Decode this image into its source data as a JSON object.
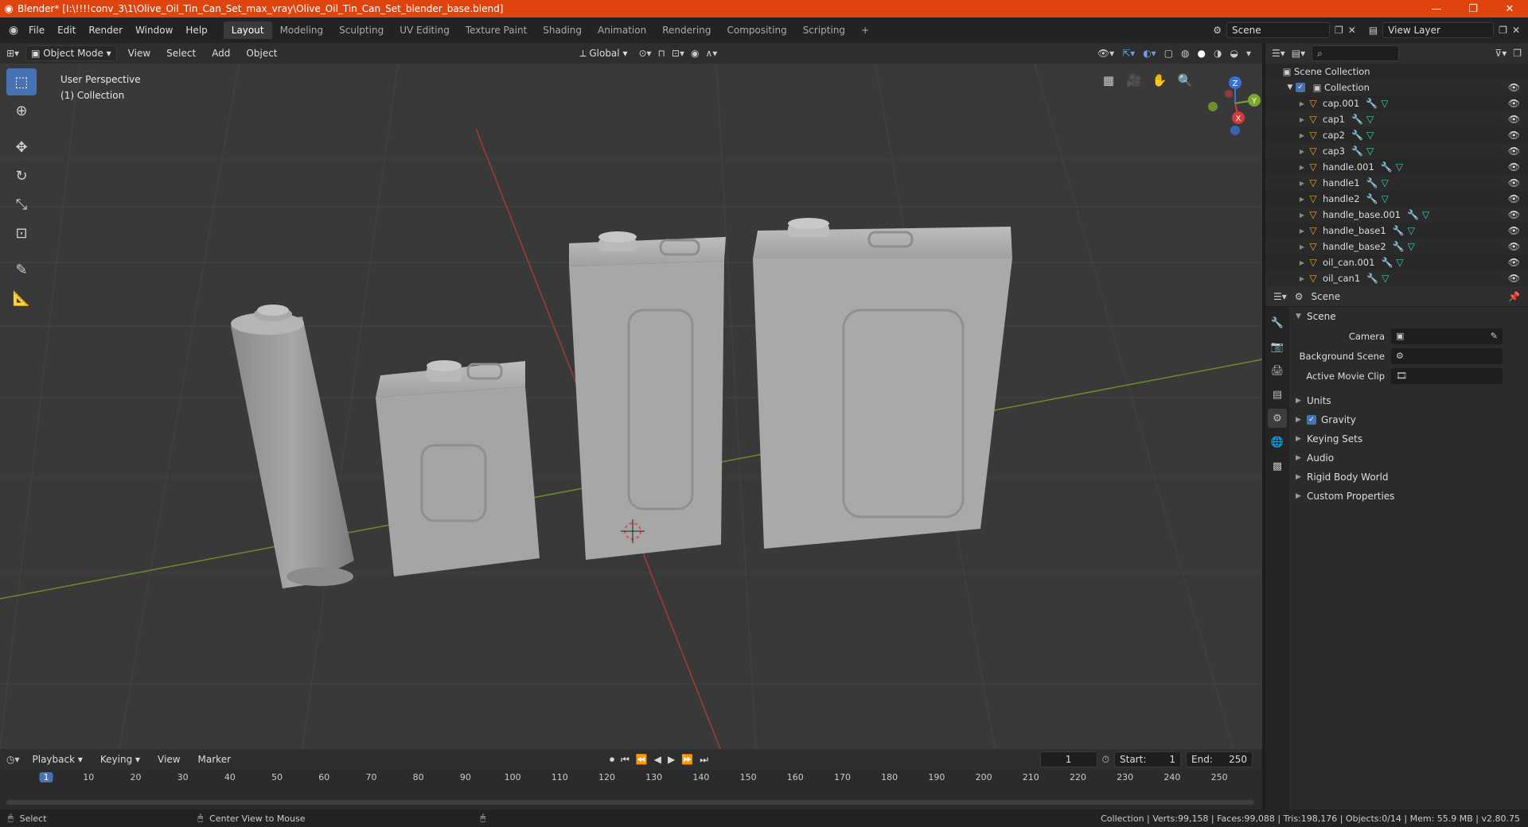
{
  "window": {
    "title": "Blender* [I:\\!!!!conv_3\\1\\Olive_Oil_Tin_Can_Set_max_vray\\Olive_Oil_Tin_Can_Set_blender_base.blend]",
    "minimize": "—",
    "maximize": "❐",
    "close": "✕"
  },
  "menu": [
    "File",
    "Edit",
    "Render",
    "Window",
    "Help"
  ],
  "workspaces": [
    {
      "label": "Layout",
      "active": true
    },
    {
      "label": "Modeling"
    },
    {
      "label": "Sculpting"
    },
    {
      "label": "UV Editing"
    },
    {
      "label": "Texture Paint"
    },
    {
      "label": "Shading"
    },
    {
      "label": "Animation"
    },
    {
      "label": "Rendering"
    },
    {
      "label": "Compositing"
    },
    {
      "label": "Scripting"
    }
  ],
  "add_workspace": "+",
  "scene_selector": "Scene",
  "view_layer": "View Layer",
  "viewport": {
    "mode": "Object Mode",
    "menus": [
      "View",
      "Select",
      "Add",
      "Object"
    ],
    "orientation": "Global",
    "overlay_label": "User Perspective",
    "collection_label": "(1) Collection",
    "gizmo": {
      "z": "Z",
      "y": "Y",
      "x": "X"
    }
  },
  "outliner": {
    "scene_collection": "Scene Collection",
    "collection": "Collection",
    "items": [
      "cap.001",
      "cap1",
      "cap2",
      "cap3",
      "handle.001",
      "handle1",
      "handle2",
      "handle_base.001",
      "handle_base1",
      "handle_base2",
      "oil_can.001",
      "oil_can1"
    ]
  },
  "properties": {
    "header": "Scene",
    "panel": "Scene",
    "rows": [
      {
        "label": "Camera",
        "value": ""
      },
      {
        "label": "Background Scene",
        "value": ""
      },
      {
        "label": "Active Movie Clip",
        "value": ""
      }
    ],
    "subpanels": [
      {
        "label": "Units",
        "checkbox": false
      },
      {
        "label": "Gravity",
        "checkbox": true
      },
      {
        "label": "Keying Sets",
        "checkbox": false
      },
      {
        "label": "Audio",
        "checkbox": false
      },
      {
        "label": "Rigid Body World",
        "checkbox": false
      },
      {
        "label": "Custom Properties",
        "checkbox": false
      }
    ]
  },
  "timeline": {
    "menus": [
      "Playback",
      "Keying",
      "View",
      "Marker"
    ],
    "current_frame": "1",
    "start_label": "Start:",
    "start": "1",
    "end_label": "End:",
    "end": "250",
    "ticks": [
      "1",
      "10",
      "20",
      "30",
      "40",
      "50",
      "60",
      "70",
      "80",
      "90",
      "100",
      "110",
      "120",
      "130",
      "140",
      "150",
      "160",
      "170",
      "180",
      "190",
      "200",
      "210",
      "220",
      "230",
      "240",
      "250"
    ]
  },
  "status": {
    "left_action": "Select",
    "middle_action": "Center View to Mouse",
    "stats": "Collection | Verts:99,158 | Faces:99,088 | Tris:198,176 | Objects:0/14 | Mem: 55.9 MB | v2.80.75"
  }
}
